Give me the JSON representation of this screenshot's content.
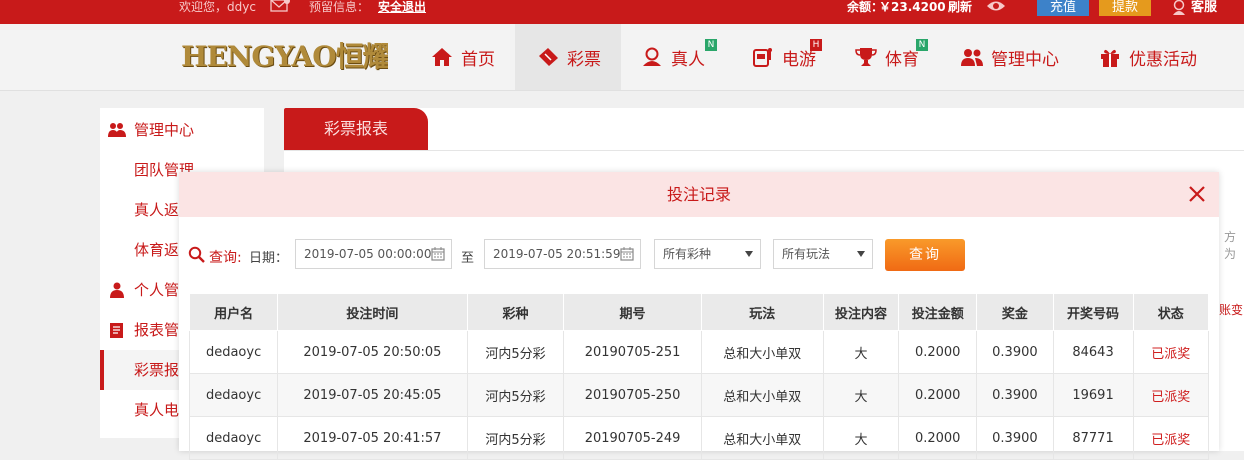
{
  "topbar": {
    "welcome": "欢迎您，ddyc",
    "reserved_info": "预留信息：",
    "logout": "安全退出",
    "balance_label": "余额：",
    "balance": "￥23.4200",
    "refresh": "刷新",
    "recharge": "充值",
    "withdraw": "提款",
    "service": "客服"
  },
  "header": {
    "logo_text": "HENGYAO恒耀",
    "nav": [
      {
        "label": "首页",
        "badge": ""
      },
      {
        "label": "彩票",
        "badge": ""
      },
      {
        "label": "真人",
        "badge": "N"
      },
      {
        "label": "电游",
        "badge": "H"
      },
      {
        "label": "体育",
        "badge": "N"
      },
      {
        "label": "管理中心",
        "badge": ""
      },
      {
        "label": "优惠活动",
        "badge": ""
      }
    ]
  },
  "sidebar": {
    "items": [
      {
        "label": "管理中心"
      },
      {
        "label": "团队管理"
      },
      {
        "label": "真人返"
      },
      {
        "label": "体育返"
      },
      {
        "label": "个人管"
      },
      {
        "label": "报表管"
      },
      {
        "label": "彩票报"
      },
      {
        "label": "真人电"
      }
    ]
  },
  "content": {
    "tab": "彩票报表",
    "edge_text_1": "方为",
    "edge_text_2": "账变"
  },
  "modal": {
    "title": "投注记录",
    "query_label": "查询:",
    "date_label": "日期：",
    "date_from": "2019-07-05 00:00:00",
    "to_label": "至",
    "date_to": "2019-07-05 20:51:59",
    "lottery_select": "所有彩种",
    "play_select": "所有玩法",
    "query_button": "查询",
    "columns": [
      "用户名",
      "投注时间",
      "彩种",
      "期号",
      "玩法",
      "投注内容",
      "投注金额",
      "奖金",
      "开奖号码",
      "状态"
    ],
    "rows": [
      [
        "dedaoyc",
        "2019-07-05 20:50:05",
        "河内5分彩",
        "20190705-251",
        "总和大小单双",
        "大",
        "0.2000",
        "0.3900",
        "84643",
        "已派奖"
      ],
      [
        "dedaoyc",
        "2019-07-05 20:45:05",
        "河内5分彩",
        "20190705-250",
        "总和大小单双",
        "大",
        "0.2000",
        "0.3900",
        "19691",
        "已派奖"
      ],
      [
        "dedaoyc",
        "2019-07-05 20:41:57",
        "河内5分彩",
        "20190705-249",
        "总和大小单双",
        "大",
        "0.2000",
        "0.3900",
        "87771",
        "已派奖"
      ]
    ]
  }
}
